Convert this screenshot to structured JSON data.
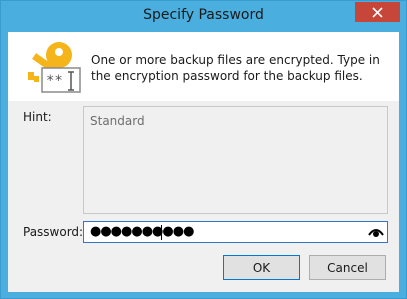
{
  "window": {
    "title": "Specify Password",
    "accent_color": "#4aaedf",
    "close_icon": "close-icon"
  },
  "header": {
    "icon": "key-password-icon",
    "message": "One or more backup files are encrypted. Type in the encryption password for the backup files."
  },
  "form": {
    "hint_label": "Hint:",
    "hint_value": "Standard",
    "password_label": "Password:",
    "password_masked": "●●●●●●●●●●",
    "reveal_icon": "eye-icon"
  },
  "buttons": {
    "ok_label": "OK",
    "cancel_label": "Cancel"
  }
}
